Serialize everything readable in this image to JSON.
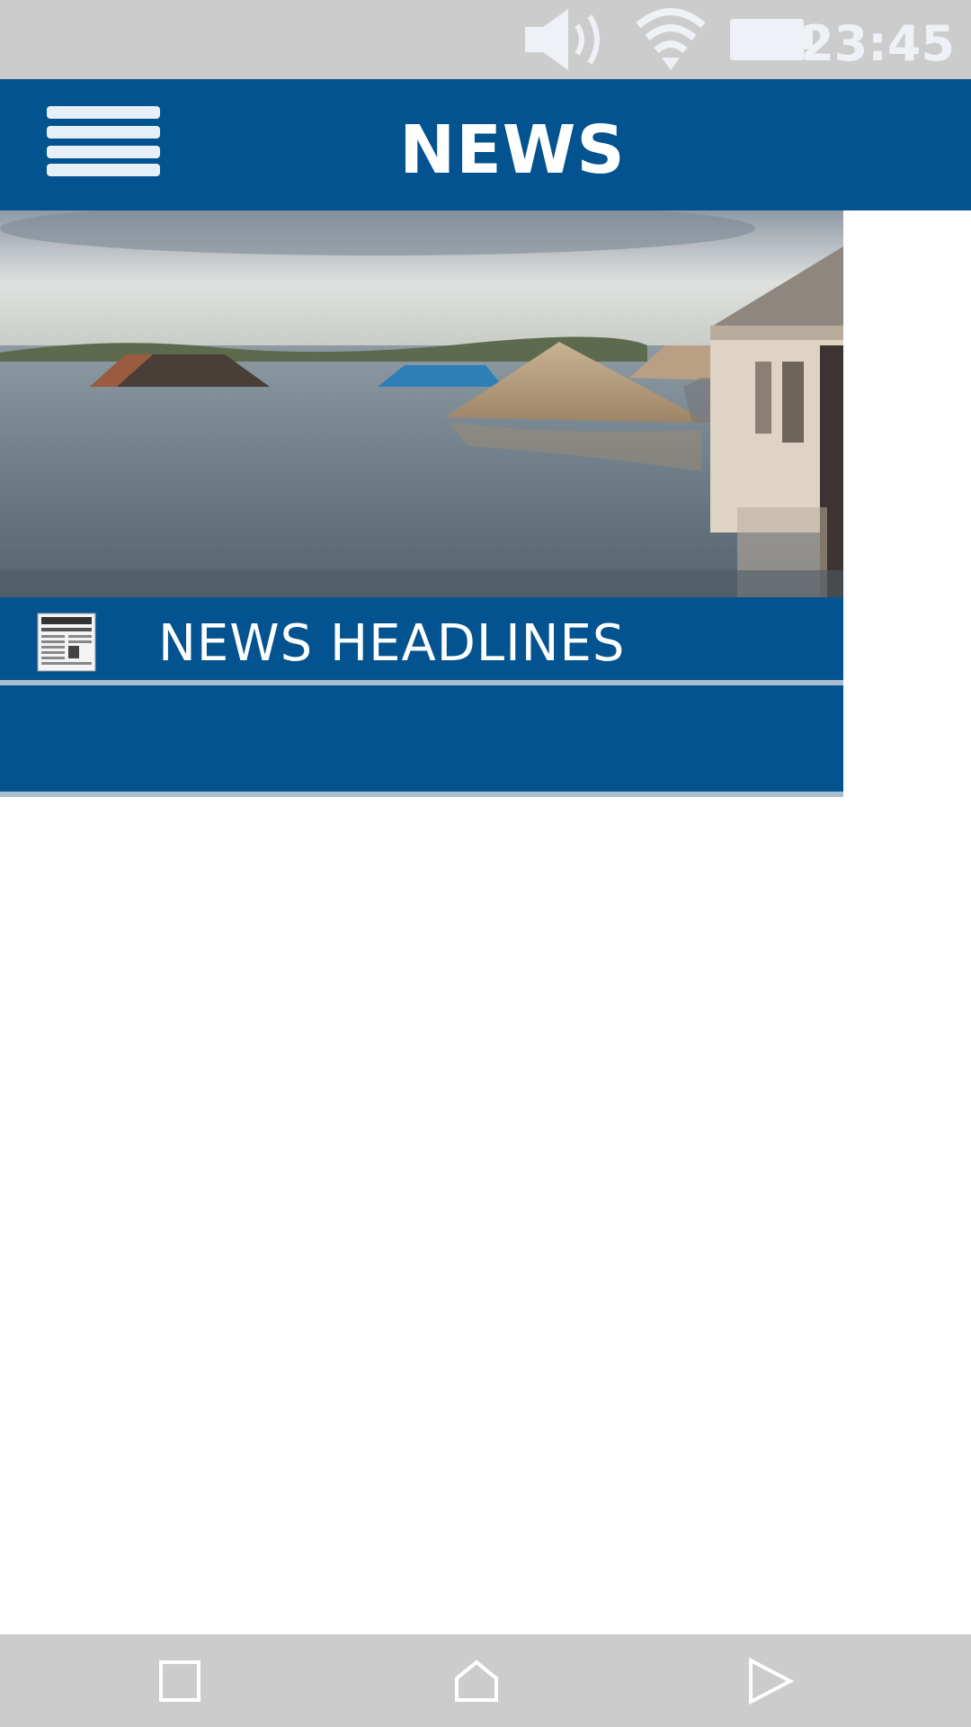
{
  "status_bar": {
    "time": "23:45",
    "icons": [
      "volume-icon",
      "wifi-icon",
      "battery-icon"
    ]
  },
  "app_bar": {
    "title": "NEWS",
    "menu_icon": "hamburger-menu-icon"
  },
  "hero": {
    "description_icon": "flood-photo"
  },
  "menu_items": [
    {
      "label": "NEWS HEADLINES",
      "icon": "newspaper-icon"
    }
  ],
  "nav_bar": {
    "buttons": [
      "recents-square-icon",
      "home-icon",
      "back-triangle-icon"
    ]
  },
  "colors": {
    "primary": "#02538f",
    "status_bar": "#cccccc",
    "divider": "#a9bdd0"
  }
}
